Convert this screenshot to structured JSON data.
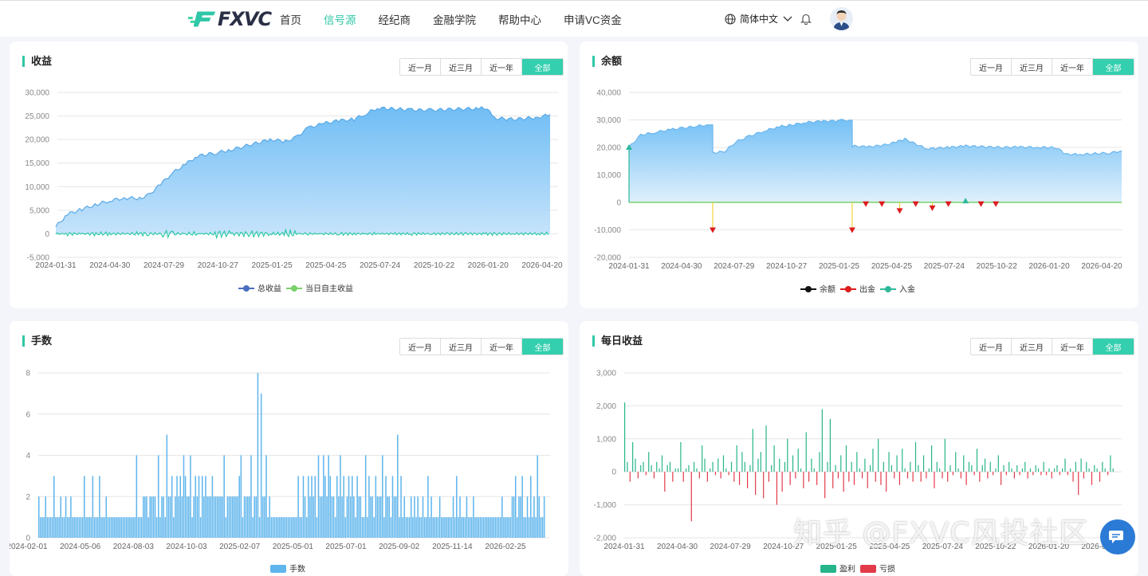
{
  "header": {
    "logo": "FXVC",
    "nav": [
      "首页",
      "信号源",
      "经纪商",
      "金融学院",
      "帮助中心",
      "申请VC资金"
    ],
    "active_nav": 1,
    "language": "简体中文"
  },
  "range_buttons": [
    "近一月",
    "近三月",
    "近一年",
    "全部"
  ],
  "colors": {
    "accent": "#33cfae",
    "area": "#7ec4f5",
    "profit": "#26b58a",
    "loss": "#e33a4a",
    "bar": "#5fb5ec"
  },
  "watermark": "知乎 @FXVC风投社区",
  "charts": {
    "profit": {
      "title": "收益",
      "yticks": [
        "30,000",
        "25,000",
        "20,000",
        "15,000",
        "10,000",
        "5,000",
        "0",
        "-5,000"
      ],
      "xticks": [
        "2024-01-31",
        "2024-04-30",
        "2024-07-29",
        "2024-10-27",
        "2025-01-25",
        "2025-04-25",
        "2025-07-24",
        "2025-10-22",
        "2026-01-20",
        "2026-04-20"
      ],
      "legend": [
        "总收益",
        "当日自主收益"
      ]
    },
    "balance": {
      "title": "余额",
      "yticks": [
        "40,000",
        "30,000",
        "20,000",
        "10,000",
        "0",
        "-10,000",
        "-20,000"
      ],
      "xticks": [
        "2024-01-31",
        "2024-04-30",
        "2024-07-29",
        "2024-10-27",
        "2025-01-25",
        "2025-04-25",
        "2025-07-24",
        "2025-10-22",
        "2026-01-20",
        "2026-04-20"
      ],
      "legend": [
        "余额",
        "出金",
        "入金"
      ]
    },
    "lots": {
      "title": "手数",
      "yticks": [
        "8",
        "6",
        "4",
        "2",
        "0"
      ],
      "xticks": [
        "2024-02-01",
        "2024-05-06",
        "2024-08-03",
        "2024-10-03",
        "2025-02-07",
        "2025-05-01",
        "2025-07-01",
        "2025-09-02",
        "2025-11-14",
        "2026-02-25"
      ],
      "legend": [
        "手数"
      ]
    },
    "daily": {
      "title": "每日收益",
      "yticks": [
        "3,000",
        "2,000",
        "1,000",
        "0",
        "-1,000",
        "-2,000"
      ],
      "xticks": [
        "2024-01-31",
        "2024-04-30",
        "2024-07-29",
        "2024-10-27",
        "2025-01-25",
        "2025-04-25",
        "2025-07-24",
        "2025-10-22",
        "2026-01-20",
        "2026-04-20"
      ],
      "legend": [
        "盈利",
        "亏损"
      ]
    }
  },
  "chart_data": [
    {
      "type": "area",
      "title": "收益",
      "ylim": [
        -5000,
        30000
      ],
      "x": [
        "2024-01-31",
        "2024-02-20",
        "2024-03-15",
        "2024-04-10",
        "2024-04-30",
        "2024-05-25",
        "2024-06-20",
        "2024-07-05",
        "2024-07-29",
        "2024-08-15",
        "2024-09-05",
        "2024-09-25",
        "2024-10-27",
        "2024-11-20",
        "2024-12-20",
        "2025-01-25",
        "2025-02-20",
        "2025-03-10",
        "2025-03-30",
        "2025-04-25",
        "2025-05-20",
        "2025-06-15",
        "2025-07-05",
        "2025-07-24",
        "2025-08-20",
        "2025-09-20",
        "2025-10-22",
        "2025-11-20",
        "2025-12-20",
        "2026-01-10",
        "2026-01-20",
        "2026-02-10",
        "2026-03-10",
        "2026-04-20",
        "2026-05-10"
      ],
      "series": [
        {
          "name": "总收益",
          "values": [
            1500,
            4200,
            5200,
            6300,
            7000,
            7600,
            7500,
            8200,
            11000,
            13000,
            14800,
            16500,
            17200,
            17800,
            18800,
            20000,
            19600,
            20500,
            22500,
            23400,
            24000,
            24300,
            25500,
            26700,
            26500,
            26300,
            26200,
            26400,
            26500,
            26600,
            26700,
            24500,
            24300,
            24700,
            25300
          ]
        },
        {
          "name": "当日自主收益",
          "values": [
            100,
            200,
            -300,
            150,
            0,
            300,
            -200,
            100,
            500,
            -400,
            300,
            200,
            800,
            -300,
            400,
            100,
            -600,
            300,
            200,
            0,
            100,
            -100,
            200,
            100,
            0,
            100,
            0,
            50,
            0,
            0,
            -100,
            50,
            0,
            100,
            0
          ]
        }
      ]
    },
    {
      "type": "area",
      "title": "余额",
      "ylim": [
        -20000,
        40000
      ],
      "x": [
        "2024-01-31",
        "2024-02-20",
        "2024-03-15",
        "2024-04-10",
        "2024-04-30",
        "2024-05-20",
        "2024-06-10",
        "2024-06-20",
        "2024-07-10",
        "2024-07-29",
        "2024-08-20",
        "2024-09-15",
        "2024-10-10",
        "2024-10-27",
        "2024-11-20",
        "2024-12-20",
        "2025-01-25",
        "2025-02-05",
        "2025-02-10",
        "2025-03-10",
        "2025-04-10",
        "2025-04-25",
        "2025-05-10",
        "2025-06-15",
        "2025-07-24",
        "2025-08-20",
        "2025-09-20",
        "2025-10-22",
        "2025-11-20",
        "2025-12-20",
        "2026-01-20",
        "2026-02-05",
        "2026-03-01",
        "2026-04-20",
        "2026-05-10"
      ],
      "series": [
        {
          "name": "余额",
          "values": [
            20000,
            24500,
            25500,
            26500,
            27000,
            27600,
            28200,
            18000,
            18500,
            22000,
            24000,
            26000,
            27500,
            28000,
            29000,
            29500,
            29800,
            29900,
            20500,
            20200,
            21000,
            22000,
            23000,
            19500,
            20000,
            20500,
            20200,
            20000,
            20100,
            20000,
            19900,
            17500,
            17400,
            18000,
            18700
          ]
        }
      ],
      "withdrawals": [
        {
          "x": "2024-06-20",
          "value": -10000
        },
        {
          "x": "2025-02-10",
          "value": -10000
        },
        {
          "x": "2025-03-05",
          "value": -500
        },
        {
          "x": "2025-04-01",
          "value": -500
        },
        {
          "x": "2025-05-01",
          "value": -3000
        },
        {
          "x": "2025-05-28",
          "value": -500
        },
        {
          "x": "2025-06-25",
          "value": -2000
        },
        {
          "x": "2025-07-22",
          "value": -500
        },
        {
          "x": "2025-09-15",
          "value": -500
        },
        {
          "x": "2025-10-10",
          "value": -500
        }
      ],
      "deposits": [
        {
          "x": "2024-01-31",
          "value": 20000
        },
        {
          "x": "2025-08-20",
          "value": 500
        }
      ]
    },
    {
      "type": "bar",
      "title": "手数",
      "ylim": [
        0,
        8
      ],
      "series": [
        {
          "name": "手数",
          "values": [
            2,
            1,
            1,
            1,
            2,
            1,
            1,
            1,
            1,
            3,
            1,
            1,
            1,
            2,
            1,
            1,
            2,
            1,
            1,
            2,
            1,
            1,
            1,
            1,
            1,
            1,
            1,
            3,
            1,
            1,
            1,
            1,
            3,
            1,
            1,
            1,
            3,
            1,
            1,
            1,
            2,
            1,
            1,
            1,
            1,
            1,
            1,
            1,
            1,
            1,
            1,
            1,
            1,
            1,
            1,
            1,
            1,
            1,
            4,
            1,
            1,
            1,
            2,
            2,
            2,
            1,
            2,
            2,
            2,
            2,
            1,
            4,
            1,
            2,
            2,
            1,
            5,
            2,
            2,
            3,
            1,
            2,
            3,
            2,
            3,
            2,
            4,
            3,
            2,
            2,
            4,
            1,
            2,
            3,
            2,
            3,
            1,
            3,
            2,
            3,
            2,
            2,
            2,
            3,
            2,
            2,
            2,
            2,
            2,
            2,
            4,
            1,
            2,
            2,
            2,
            2,
            2,
            2,
            2,
            3,
            4,
            1,
            2,
            2,
            2,
            2,
            4,
            1,
            2,
            2,
            8,
            1,
            7,
            2,
            2,
            4,
            1,
            2,
            1,
            1,
            1,
            1,
            1,
            1,
            1,
            1,
            1,
            1,
            1,
            1,
            1,
            1,
            1,
            1,
            3,
            1,
            1,
            3,
            2,
            1,
            3,
            2,
            3,
            2,
            3,
            1,
            4,
            2,
            2,
            4,
            3,
            2,
            4,
            3,
            2,
            2,
            1,
            3,
            2,
            4,
            2,
            3,
            1,
            2,
            3,
            2,
            3,
            2,
            1,
            3,
            2,
            2,
            1,
            1,
            4,
            1,
            3,
            2,
            2,
            1,
            3,
            2,
            2,
            2,
            4,
            1,
            3,
            2,
            2,
            1,
            3,
            2,
            2,
            5,
            1,
            3,
            1,
            2,
            1,
            1,
            1,
            2,
            1,
            2,
            1,
            2,
            1,
            1,
            2,
            1,
            1,
            3,
            1,
            2,
            1,
            1,
            1,
            1,
            2,
            1,
            1,
            1,
            1,
            1,
            1,
            1,
            2,
            1,
            3,
            1,
            2,
            1,
            1,
            1,
            2,
            1,
            1,
            1,
            2,
            1,
            1,
            1,
            1,
            1,
            1,
            1,
            1,
            1,
            1,
            1,
            1,
            1,
            1,
            1,
            1,
            2,
            1,
            1,
            1,
            1,
            1,
            2,
            2,
            3,
            1,
            2,
            2,
            3,
            1,
            1,
            2,
            1,
            3,
            1,
            2,
            1,
            4,
            2,
            1,
            1,
            2
          ]
        }
      ]
    },
    {
      "type": "bar",
      "title": "每日收益",
      "ylim": [
        -2000,
        3000
      ],
      "series": [
        {
          "name": "每日收益",
          "values": [
            2100,
            300,
            -300,
            900,
            400,
            -200,
            200,
            300,
            -100,
            600,
            200,
            -200,
            300,
            100,
            500,
            -600,
            200,
            300,
            -300,
            100,
            100,
            900,
            -300,
            100,
            200,
            -1500,
            300,
            100,
            -200,
            800,
            400,
            -300,
            100,
            300,
            -100,
            400,
            -200,
            500,
            100,
            -100,
            300,
            -300,
            800,
            -400,
            600,
            300,
            -500,
            200,
            1300,
            -700,
            400,
            600,
            -800,
            1400,
            -300,
            200,
            800,
            -1000,
            400,
            -600,
            300,
            1000,
            -400,
            500,
            -200,
            700,
            100,
            -500,
            1200,
            -300,
            400,
            100,
            -400,
            600,
            1900,
            -800,
            300,
            1600,
            -500,
            200,
            -200,
            500,
            -600,
            800,
            -300,
            300,
            -400,
            600,
            100,
            -200,
            400,
            -500,
            200,
            700,
            -300,
            1000,
            -400,
            300,
            -600,
            600,
            200,
            -200,
            500,
            -400,
            700,
            100,
            -200,
            300,
            -300,
            900,
            200,
            -300,
            500,
            -200,
            100,
            800,
            -500,
            300,
            100,
            -200,
            1000,
            -300,
            200,
            -100,
            600,
            100,
            -200,
            500,
            -400,
            300,
            200,
            -100,
            700,
            -300,
            200,
            400,
            -200,
            300,
            -100,
            100,
            500,
            -400,
            200,
            -100,
            300,
            100,
            -200,
            200,
            -100,
            100,
            300,
            -200,
            100,
            -100,
            200,
            100,
            -100,
            300,
            -100,
            100,
            -200,
            100,
            200,
            -100,
            100,
            400,
            -100,
            100,
            -300,
            300,
            -700,
            400,
            -200,
            300,
            100,
            -400,
            200,
            100,
            -300,
            300,
            100,
            -100,
            500,
            100
          ]
        }
      ],
      "legend_series": [
        "盈利",
        "亏损"
      ]
    }
  ]
}
